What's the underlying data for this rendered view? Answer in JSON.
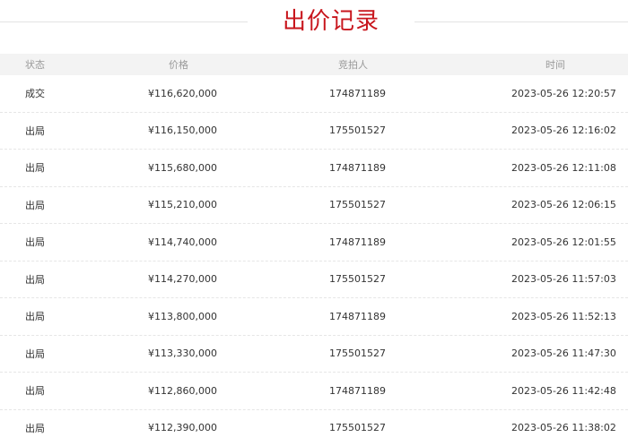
{
  "title": "出价记录",
  "columns": {
    "status": "状态",
    "price": "价格",
    "bidder": "竞拍人",
    "time": "时间"
  },
  "rows": [
    {
      "status": "成交",
      "price": "¥116,620,000",
      "bidder": "174871189",
      "time": "2023-05-26 12:20:57"
    },
    {
      "status": "出局",
      "price": "¥116,150,000",
      "bidder": "175501527",
      "time": "2023-05-26 12:16:02"
    },
    {
      "status": "出局",
      "price": "¥115,680,000",
      "bidder": "174871189",
      "time": "2023-05-26 12:11:08"
    },
    {
      "status": "出局",
      "price": "¥115,210,000",
      "bidder": "175501527",
      "time": "2023-05-26 12:06:15"
    },
    {
      "status": "出局",
      "price": "¥114,740,000",
      "bidder": "174871189",
      "time": "2023-05-26 12:01:55"
    },
    {
      "status": "出局",
      "price": "¥114,270,000",
      "bidder": "175501527",
      "time": "2023-05-26 11:57:03"
    },
    {
      "status": "出局",
      "price": "¥113,800,000",
      "bidder": "174871189",
      "time": "2023-05-26 11:52:13"
    },
    {
      "status": "出局",
      "price": "¥113,330,000",
      "bidder": "175501527",
      "time": "2023-05-26 11:47:30"
    },
    {
      "status": "出局",
      "price": "¥112,860,000",
      "bidder": "174871189",
      "time": "2023-05-26 11:42:48"
    },
    {
      "status": "出局",
      "price": "¥112,390,000",
      "bidder": "175501527",
      "time": "2023-05-26 11:38:02"
    }
  ],
  "colors": {
    "title": "#c8161d",
    "header_bg": "#f3f3f3",
    "header_text": "#999999",
    "body_text": "#333333"
  }
}
